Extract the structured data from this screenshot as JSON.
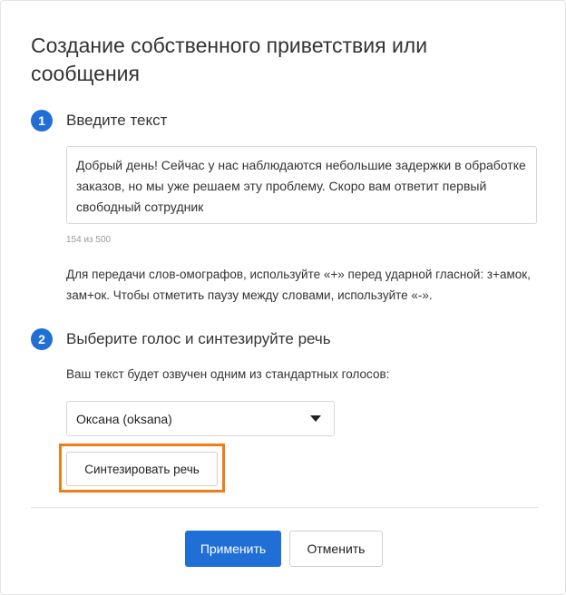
{
  "dialog": {
    "title": "Создание собственного приветствия или сообщения"
  },
  "step1": {
    "number": "1",
    "title": "Введите текст",
    "text_value": "Добрый день! Сейчас у нас наблюдаются небольшие задержки в обработке заказов, но мы уже решаем эту проблему. Скоро вам ответит первый свободный сотрудник",
    "counter": "154 из 500",
    "hint": "Для передачи слов-омографов, используйте «+» перед ударной гласной: з+амок, зам+ок. Чтобы отметить паузу между словами, используйте «-»."
  },
  "step2": {
    "number": "2",
    "title": "Выберите голос и синтезируйте речь",
    "description": "Ваш текст будет озвучен одним из стандартных голосов:",
    "voice_selected": "Оксана (oksana)",
    "synth_button": "Синтезировать речь"
  },
  "footer": {
    "apply_button": "Применить",
    "cancel_button": "Отменить"
  },
  "colors": {
    "accent": "#1f6fd6",
    "highlight": "#f07d17"
  }
}
